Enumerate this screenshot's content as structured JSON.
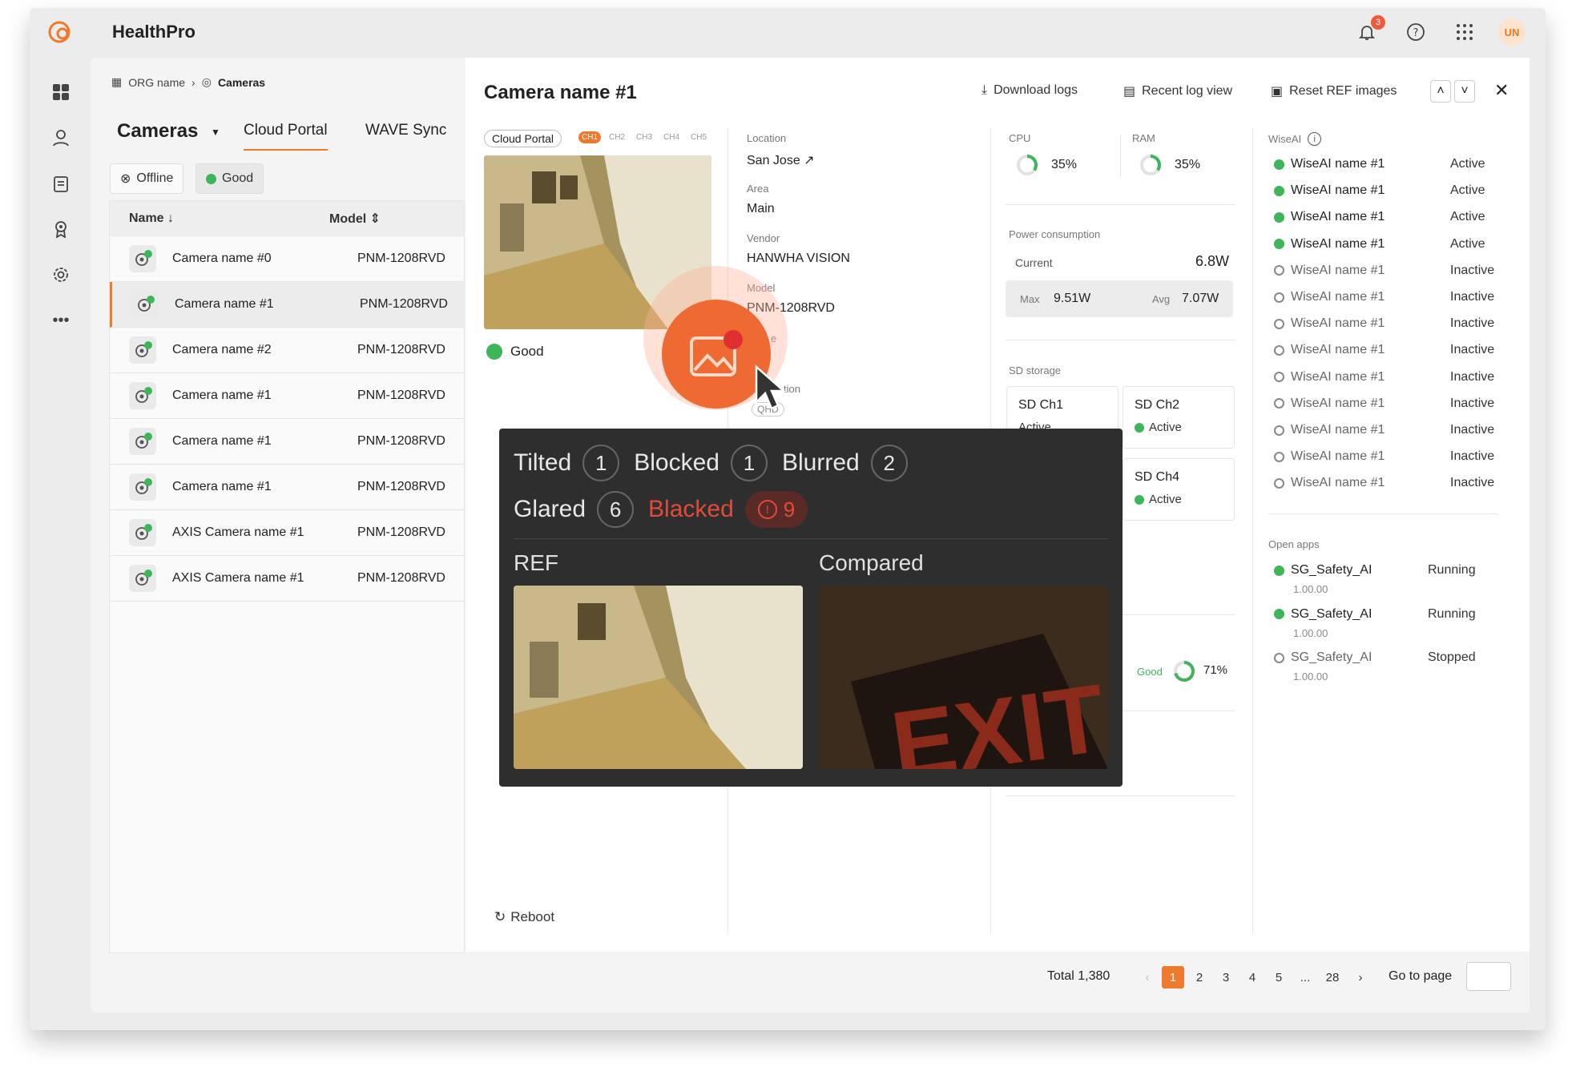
{
  "app": {
    "brand": "HealthPro",
    "notif_count": "3",
    "avatar": "UN"
  },
  "colors": {
    "accent": "#ef7a2e",
    "good": "#3fb55a",
    "alert": "#e24b3a"
  },
  "breadcrumb": {
    "org": "ORG name",
    "current": "Cameras"
  },
  "list": {
    "title": "Cameras",
    "tabs": [
      "Cloud Portal",
      "WAVE Sync"
    ],
    "filters": {
      "offline": "Offline",
      "good": "Good"
    },
    "columns": {
      "name": "Name",
      "model": "Model"
    },
    "rows": [
      {
        "name": "Camera name #0",
        "model": "PNM-1208RVD"
      },
      {
        "name": "Camera name #1",
        "model": "PNM-1208RVD"
      },
      {
        "name": "Camera name #2",
        "model": "PNM-1208RVD"
      },
      {
        "name": "Camera name #1",
        "model": "PNM-1208RVD"
      },
      {
        "name": "Camera name #1",
        "model": "PNM-1208RVD"
      },
      {
        "name": "Camera name #1",
        "model": "PNM-1208RVD"
      },
      {
        "name": "AXIS Camera name #1",
        "model": "PNM-1208RVD"
      },
      {
        "name": "AXIS Camera name #1",
        "model": "PNM-1208RVD"
      }
    ]
  },
  "detail": {
    "title": "Camera name #1",
    "actions": {
      "download": "Download logs",
      "recent": "Recent log view",
      "reset": "Reset REF images"
    },
    "source": "Cloud Portal",
    "channels": [
      "CH1",
      "CH2",
      "CH3",
      "CH4",
      "CH5"
    ],
    "status": "Good",
    "reboot": "Reboot",
    "info": {
      "location_label": "Location",
      "location": "San Jose",
      "area_label": "Area",
      "area": "Main",
      "vendor_label": "Vendor",
      "vendor": "HANWHA VISION",
      "model_label": "Model",
      "model": "PNM-1208RVD",
      "res_label_tail": "tion",
      "res": "QHD",
      "type_frag": "e"
    },
    "cpu": {
      "label": "CPU",
      "value": "35%"
    },
    "ram": {
      "label": "RAM",
      "value": "35%"
    },
    "power": {
      "label": "Power consumption",
      "current_label": "Current",
      "current": "6.8W",
      "max_label": "Max",
      "max": "9.51W",
      "avg_label": "Avg",
      "avg": "7.07W"
    },
    "sd": {
      "label": "SD storage",
      "ch1": "SD Ch1",
      "ch1_status": "Active",
      "ch2": "SD Ch2",
      "ch2_status": "Active",
      "ch4": "SD Ch4",
      "ch4_status": "Active",
      "health_label": "Good",
      "health": "71%"
    },
    "wiseai": {
      "label": "WiseAI",
      "items": [
        {
          "name": "WiseAI name #1",
          "status": "Active"
        },
        {
          "name": "WiseAI name #1",
          "status": "Active"
        },
        {
          "name": "WiseAI name #1",
          "status": "Active"
        },
        {
          "name": "WiseAI name #1",
          "status": "Active"
        },
        {
          "name": "WiseAI name #1",
          "status": "Inactive"
        },
        {
          "name": "WiseAI name #1",
          "status": "Inactive"
        },
        {
          "name": "WiseAI name #1",
          "status": "Inactive"
        },
        {
          "name": "WiseAI name #1",
          "status": "Inactive"
        },
        {
          "name": "WiseAI name #1",
          "status": "Inactive"
        },
        {
          "name": "WiseAI name #1",
          "status": "Inactive"
        },
        {
          "name": "WiseAI name #1",
          "status": "Inactive"
        },
        {
          "name": "WiseAI name #1",
          "status": "Inactive"
        },
        {
          "name": "WiseAI name #1",
          "status": "Inactive"
        }
      ]
    },
    "apps": {
      "label": "Open apps",
      "items": [
        {
          "name": "SG_Safety_AI",
          "version": "1.00.00",
          "status": "Running"
        },
        {
          "name": "SG_Safety_AI",
          "version": "1.00.00",
          "status": "Running"
        },
        {
          "name": "SG_Safety_AI",
          "version": "1.00.00",
          "status": "Stopped"
        }
      ]
    }
  },
  "overlay": {
    "tilted": "Tilted",
    "tilted_n": "1",
    "blocked": "Blocked",
    "blocked_n": "1",
    "blurred": "Blurred",
    "blurred_n": "2",
    "glared": "Glared",
    "glared_n": "6",
    "blacked": "Blacked",
    "blacked_n": "9",
    "ref": "REF",
    "compared": "Compared",
    "compared_sign": "EXIT"
  },
  "pagination": {
    "total": "Total 1,380",
    "pages": [
      "1",
      "2",
      "3",
      "4",
      "5",
      "...",
      "28"
    ],
    "goto": "Go to page"
  }
}
